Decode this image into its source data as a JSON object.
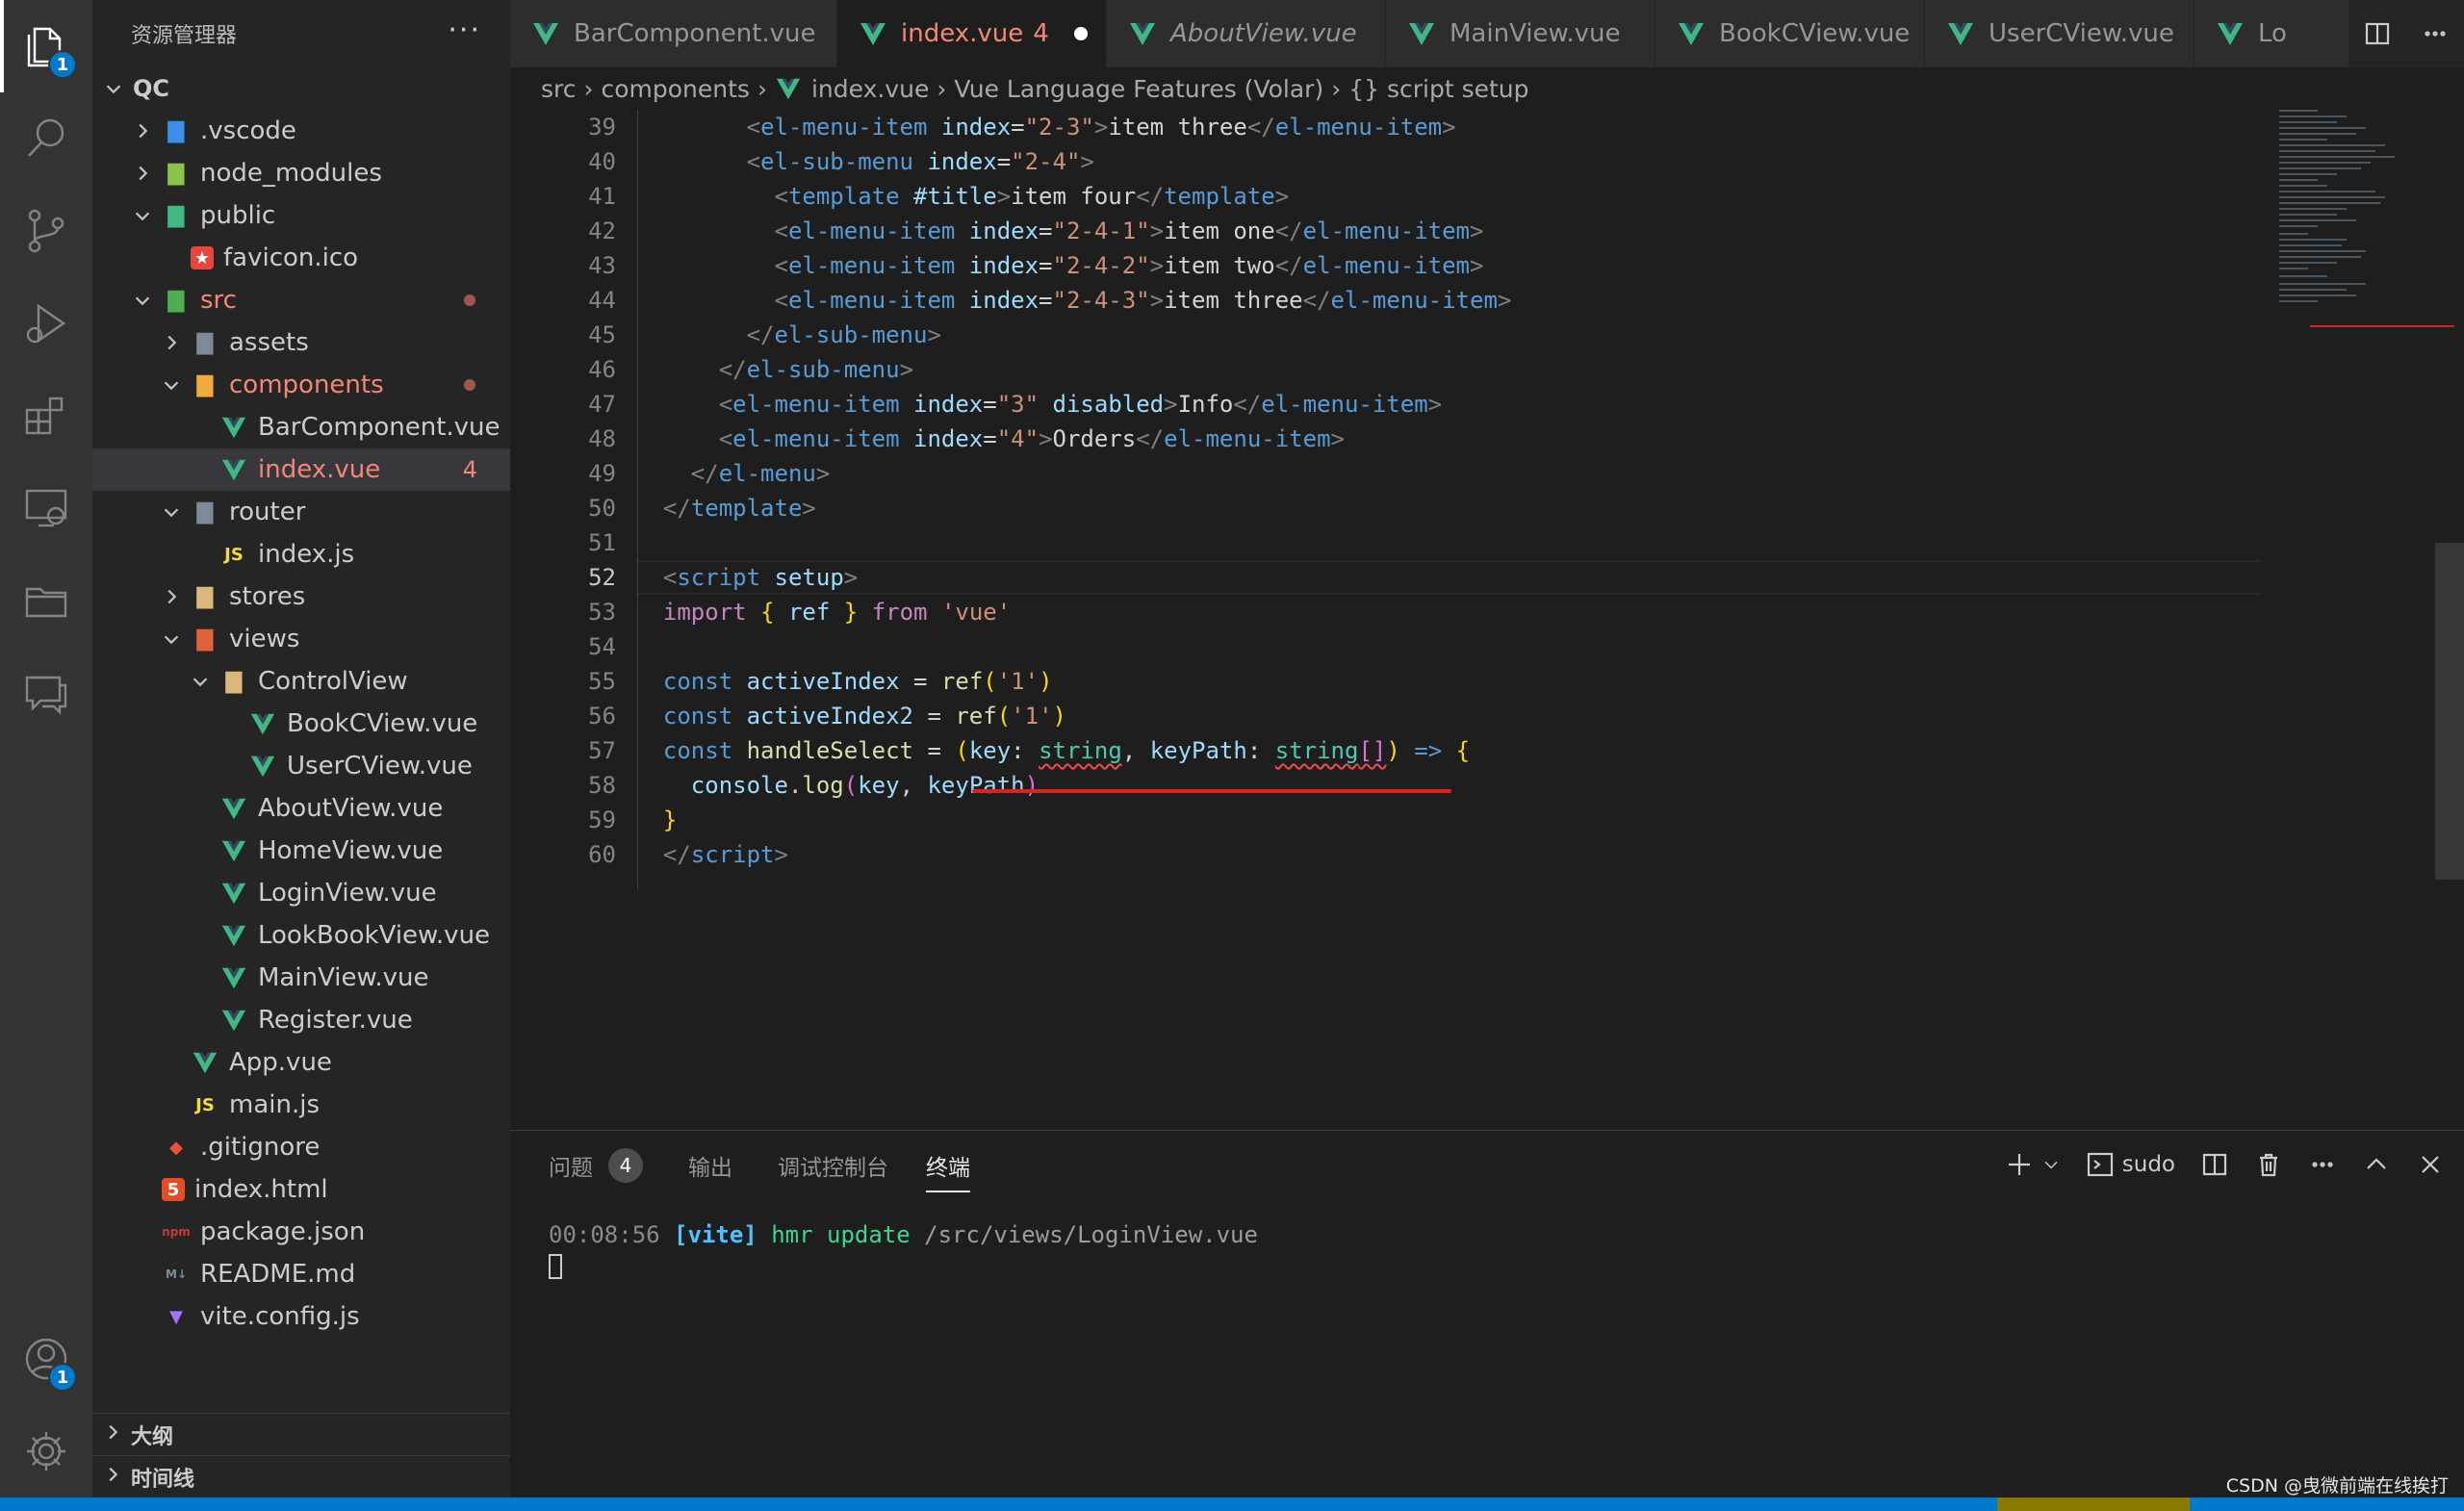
{
  "colors": {
    "vue_green": "#41b883",
    "error": "#f48771",
    "modified": "#e2c08d",
    "accent": "#007acc"
  },
  "activity_bar": {
    "explorer_badge": "1",
    "account_badge": "1"
  },
  "sidebar": {
    "title": "资源管理器",
    "more": "···",
    "root": "QC",
    "tree": [
      {
        "label": ".vscode",
        "indent": 1,
        "chevron": "right",
        "icon": "folder-vscode-icon"
      },
      {
        "label": "node_modules",
        "indent": 1,
        "chevron": "right",
        "icon": "folder-node-icon"
      },
      {
        "label": "public",
        "indent": 1,
        "chevron": "down",
        "icon": "folder-public-icon"
      },
      {
        "label": "favicon.ico",
        "indent": 2,
        "chevron": "",
        "icon": "favicon-file-icon"
      },
      {
        "label": "src",
        "indent": 1,
        "chevron": "down",
        "icon": "folder-src-icon",
        "state": "err",
        "dot": true
      },
      {
        "label": "assets",
        "indent": 2,
        "chevron": "right",
        "icon": "folder-assets-icon"
      },
      {
        "label": "components",
        "indent": 2,
        "chevron": "down",
        "icon": "folder-components-icon",
        "state": "err",
        "dot": true
      },
      {
        "label": "BarComponent.vue",
        "indent": 3,
        "chevron": "",
        "icon": "vue-file-icon"
      },
      {
        "label": "index.vue",
        "indent": 3,
        "chevron": "",
        "icon": "vue-file-icon",
        "state": "err",
        "count": "4",
        "selected": true
      },
      {
        "label": "router",
        "indent": 2,
        "chevron": "down",
        "icon": "folder-router-icon"
      },
      {
        "label": "index.js",
        "indent": 3,
        "chevron": "",
        "icon": "js-file-icon"
      },
      {
        "label": "stores",
        "indent": 2,
        "chevron": "right",
        "icon": "folder-icon"
      },
      {
        "label": "views",
        "indent": 2,
        "chevron": "down",
        "icon": "folder-views-icon"
      },
      {
        "label": "ControlView",
        "indent": 3,
        "chevron": "down",
        "icon": "folder-open-icon"
      },
      {
        "label": "BookCView.vue",
        "indent": 4,
        "chevron": "",
        "icon": "vue-file-icon"
      },
      {
        "label": "UserCView.vue",
        "indent": 4,
        "chevron": "",
        "icon": "vue-file-icon"
      },
      {
        "label": "AboutView.vue",
        "indent": 3,
        "chevron": "",
        "icon": "vue-file-icon"
      },
      {
        "label": "HomeView.vue",
        "indent": 3,
        "chevron": "",
        "icon": "vue-file-icon"
      },
      {
        "label": "LoginView.vue",
        "indent": 3,
        "chevron": "",
        "icon": "vue-file-icon"
      },
      {
        "label": "LookBookView.vue",
        "indent": 3,
        "chevron": "",
        "icon": "vue-file-icon"
      },
      {
        "label": "MainView.vue",
        "indent": 3,
        "chevron": "",
        "icon": "vue-file-icon"
      },
      {
        "label": "Register.vue",
        "indent": 3,
        "chevron": "",
        "icon": "vue-file-icon"
      },
      {
        "label": "App.vue",
        "indent": 2,
        "chevron": "",
        "icon": "vue-file-icon"
      },
      {
        "label": "main.js",
        "indent": 2,
        "chevron": "",
        "icon": "js-file-icon"
      },
      {
        "label": ".gitignore",
        "indent": 1,
        "chevron": "",
        "icon": "git-file-icon"
      },
      {
        "label": "index.html",
        "indent": 1,
        "chevron": "",
        "icon": "html-file-icon"
      },
      {
        "label": "package.json",
        "indent": 1,
        "chevron": "",
        "icon": "npm-file-icon"
      },
      {
        "label": "README.md",
        "indent": 1,
        "chevron": "",
        "icon": "markdown-file-icon"
      },
      {
        "label": "vite.config.js",
        "indent": 1,
        "chevron": "",
        "icon": "vite-file-icon"
      }
    ],
    "outline": "大纲",
    "timeline": "时间线"
  },
  "tabs": [
    {
      "label": "BarComponent.vue",
      "active": false,
      "italic": false
    },
    {
      "label": "index.vue",
      "active": true,
      "italic": false,
      "count": "4",
      "dirty": true
    },
    {
      "label": "AboutView.vue",
      "active": false,
      "italic": true
    },
    {
      "label": "MainView.vue",
      "active": false,
      "italic": false
    },
    {
      "label": "BookCView.vue",
      "active": false,
      "italic": false
    },
    {
      "label": "UserCView.vue",
      "active": false,
      "italic": false
    },
    {
      "label": "Lo",
      "active": false,
      "italic": false
    }
  ],
  "breadcrumb": {
    "src": "src",
    "components": "components",
    "file": "index.vue",
    "lang": "Vue Language Features (Volar)",
    "symbol": "{} script setup"
  },
  "editor": {
    "current_line": "52",
    "lines": [
      {
        "n": "39",
        "parts": [
          [
            "  ",
            "t-txt"
          ],
          [
            "      ",
            "t-txt"
          ],
          [
            "<",
            "t-br"
          ],
          [
            "el-menu-item",
            "t-tag"
          ],
          [
            " ",
            "t-txt"
          ],
          [
            "index",
            "t-attr"
          ],
          [
            "=",
            "t-txt"
          ],
          [
            "\"2-3\"",
            "t-str"
          ],
          [
            ">",
            "t-br"
          ],
          [
            "item three",
            "t-txt"
          ],
          [
            "</",
            "t-br"
          ],
          [
            "el-menu-item",
            "t-tag"
          ],
          [
            ">",
            "t-br"
          ]
        ]
      },
      {
        "n": "40",
        "parts": [
          [
            "        ",
            "t-txt"
          ],
          [
            "<",
            "t-br"
          ],
          [
            "el-sub-menu",
            "t-tag"
          ],
          [
            " ",
            "t-txt"
          ],
          [
            "index",
            "t-attr"
          ],
          [
            "=",
            "t-txt"
          ],
          [
            "\"2-4\"",
            "t-str"
          ],
          [
            ">",
            "t-br"
          ]
        ]
      },
      {
        "n": "41",
        "parts": [
          [
            "          ",
            "t-txt"
          ],
          [
            "<",
            "t-br"
          ],
          [
            "template",
            "t-tag"
          ],
          [
            " ",
            "t-txt"
          ],
          [
            "#title",
            "t-attr"
          ],
          [
            ">",
            "t-br"
          ],
          [
            "item four",
            "t-txt"
          ],
          [
            "</",
            "t-br"
          ],
          [
            "template",
            "t-tag"
          ],
          [
            ">",
            "t-br"
          ]
        ]
      },
      {
        "n": "42",
        "parts": [
          [
            "          ",
            "t-txt"
          ],
          [
            "<",
            "t-br"
          ],
          [
            "el-menu-item",
            "t-tag"
          ],
          [
            " ",
            "t-txt"
          ],
          [
            "index",
            "t-attr"
          ],
          [
            "=",
            "t-txt"
          ],
          [
            "\"2-4-1\"",
            "t-str"
          ],
          [
            ">",
            "t-br"
          ],
          [
            "item one",
            "t-txt"
          ],
          [
            "</",
            "t-br"
          ],
          [
            "el-menu-item",
            "t-tag"
          ],
          [
            ">",
            "t-br"
          ]
        ]
      },
      {
        "n": "43",
        "parts": [
          [
            "          ",
            "t-txt"
          ],
          [
            "<",
            "t-br"
          ],
          [
            "el-menu-item",
            "t-tag"
          ],
          [
            " ",
            "t-txt"
          ],
          [
            "index",
            "t-attr"
          ],
          [
            "=",
            "t-txt"
          ],
          [
            "\"2-4-2\"",
            "t-str"
          ],
          [
            ">",
            "t-br"
          ],
          [
            "item two",
            "t-txt"
          ],
          [
            "</",
            "t-br"
          ],
          [
            "el-menu-item",
            "t-tag"
          ],
          [
            ">",
            "t-br"
          ]
        ]
      },
      {
        "n": "44",
        "parts": [
          [
            "          ",
            "t-txt"
          ],
          [
            "<",
            "t-br"
          ],
          [
            "el-menu-item",
            "t-tag"
          ],
          [
            " ",
            "t-txt"
          ],
          [
            "index",
            "t-attr"
          ],
          [
            "=",
            "t-txt"
          ],
          [
            "\"2-4-3\"",
            "t-str"
          ],
          [
            ">",
            "t-br"
          ],
          [
            "item three",
            "t-txt"
          ],
          [
            "</",
            "t-br"
          ],
          [
            "el-menu-item",
            "t-tag"
          ],
          [
            ">",
            "t-br"
          ]
        ]
      },
      {
        "n": "45",
        "parts": [
          [
            "        ",
            "t-txt"
          ],
          [
            "</",
            "t-br"
          ],
          [
            "el-sub-menu",
            "t-tag"
          ],
          [
            ">",
            "t-br"
          ]
        ]
      },
      {
        "n": "46",
        "parts": [
          [
            "      ",
            "t-txt"
          ],
          [
            "</",
            "t-br"
          ],
          [
            "el-sub-menu",
            "t-tag"
          ],
          [
            ">",
            "t-br"
          ]
        ]
      },
      {
        "n": "47",
        "parts": [
          [
            "      ",
            "t-txt"
          ],
          [
            "<",
            "t-br"
          ],
          [
            "el-menu-item",
            "t-tag"
          ],
          [
            " ",
            "t-txt"
          ],
          [
            "index",
            "t-attr"
          ],
          [
            "=",
            "t-txt"
          ],
          [
            "\"3\"",
            "t-str"
          ],
          [
            " ",
            "t-txt"
          ],
          [
            "disabled",
            "t-attr"
          ],
          [
            ">",
            "t-br"
          ],
          [
            "Info",
            "t-txt"
          ],
          [
            "</",
            "t-br"
          ],
          [
            "el-menu-item",
            "t-tag"
          ],
          [
            ">",
            "t-br"
          ]
        ]
      },
      {
        "n": "48",
        "parts": [
          [
            "      ",
            "t-txt"
          ],
          [
            "<",
            "t-br"
          ],
          [
            "el-menu-item",
            "t-tag"
          ],
          [
            " ",
            "t-txt"
          ],
          [
            "index",
            "t-attr"
          ],
          [
            "=",
            "t-txt"
          ],
          [
            "\"4\"",
            "t-str"
          ],
          [
            ">",
            "t-br"
          ],
          [
            "Orders",
            "t-txt"
          ],
          [
            "</",
            "t-br"
          ],
          [
            "el-menu-item",
            "t-tag"
          ],
          [
            ">",
            "t-br"
          ]
        ]
      },
      {
        "n": "49",
        "parts": [
          [
            "    ",
            "t-txt"
          ],
          [
            "</",
            "t-br"
          ],
          [
            "el-menu",
            "t-tag"
          ],
          [
            ">",
            "t-br"
          ]
        ]
      },
      {
        "n": "50",
        "parts": [
          [
            "  ",
            "t-txt"
          ],
          [
            "</",
            "t-br"
          ],
          [
            "template",
            "t-tag"
          ],
          [
            ">",
            "t-br"
          ]
        ]
      },
      {
        "n": "51",
        "parts": []
      },
      {
        "n": "52",
        "parts": [
          [
            "  ",
            "t-txt"
          ],
          [
            "<",
            "t-br"
          ],
          [
            "script",
            "t-tag"
          ],
          [
            " ",
            "t-txt"
          ],
          [
            "setup",
            "t-attr"
          ],
          [
            ">",
            "t-br"
          ]
        ]
      },
      {
        "n": "53",
        "parts": [
          [
            "  ",
            "t-txt"
          ],
          [
            "import",
            "t-imp"
          ],
          [
            " ",
            "t-txt"
          ],
          [
            "{",
            "t-par"
          ],
          [
            " ",
            "t-txt"
          ],
          [
            "ref",
            "t-var"
          ],
          [
            " ",
            "t-txt"
          ],
          [
            "}",
            "t-par"
          ],
          [
            " ",
            "t-txt"
          ],
          [
            "from",
            "t-imp"
          ],
          [
            " ",
            "t-txt"
          ],
          [
            "'vue'",
            "t-str"
          ]
        ]
      },
      {
        "n": "54",
        "parts": []
      },
      {
        "n": "55",
        "parts": [
          [
            "  ",
            "t-txt"
          ],
          [
            "const",
            "t-kw"
          ],
          [
            " ",
            "t-txt"
          ],
          [
            "activeIndex",
            "t-var"
          ],
          [
            " = ",
            "t-txt"
          ],
          [
            "ref",
            "t-fn"
          ],
          [
            "(",
            "t-par"
          ],
          [
            "'1'",
            "t-str"
          ],
          [
            ")",
            "t-par"
          ]
        ]
      },
      {
        "n": "56",
        "parts": [
          [
            "  ",
            "t-txt"
          ],
          [
            "const",
            "t-kw"
          ],
          [
            " ",
            "t-txt"
          ],
          [
            "activeIndex2",
            "t-var"
          ],
          [
            " = ",
            "t-txt"
          ],
          [
            "ref",
            "t-fn"
          ],
          [
            "(",
            "t-par"
          ],
          [
            "'1'",
            "t-str"
          ],
          [
            ")",
            "t-par"
          ]
        ]
      },
      {
        "n": "57",
        "parts": [
          [
            "  ",
            "t-txt"
          ],
          [
            "const",
            "t-kw"
          ],
          [
            " ",
            "t-txt"
          ],
          [
            "handleSelect",
            "t-fn"
          ],
          [
            " = ",
            "t-txt"
          ],
          [
            "(",
            "t-par"
          ],
          [
            "key",
            "t-var"
          ],
          [
            ": ",
            "t-txt"
          ],
          [
            "string",
            "t-type squig"
          ],
          [
            ", ",
            "t-txt"
          ],
          [
            "keyPath",
            "t-var"
          ],
          [
            ": ",
            "t-txt"
          ],
          [
            "string",
            "t-type squig"
          ],
          [
            "[]",
            "t-par2 squig"
          ],
          [
            ")",
            "t-par"
          ],
          [
            " ",
            "t-txt"
          ],
          [
            "=>",
            "t-kw"
          ],
          [
            " ",
            "t-txt"
          ],
          [
            "{",
            "t-par"
          ]
        ]
      },
      {
        "n": "58",
        "parts": [
          [
            "    ",
            "t-txt"
          ],
          [
            "console",
            "t-var"
          ],
          [
            ".",
            "t-txt"
          ],
          [
            "log",
            "t-fn"
          ],
          [
            "(",
            "t-par2"
          ],
          [
            "key",
            "t-var"
          ],
          [
            ", ",
            "t-txt"
          ],
          [
            "keyPath",
            "t-var"
          ],
          [
            ")",
            "t-par2"
          ]
        ]
      },
      {
        "n": "59",
        "parts": [
          [
            "  ",
            "t-txt"
          ],
          [
            "}",
            "t-par"
          ]
        ]
      },
      {
        "n": "60",
        "parts": [
          [
            "  ",
            "t-txt"
          ],
          [
            "</",
            "t-br"
          ],
          [
            "script",
            "t-tag"
          ],
          [
            ">",
            "t-br"
          ]
        ]
      }
    ]
  },
  "panel": {
    "tabs": [
      {
        "label": "问题",
        "badge": "4",
        "active": false
      },
      {
        "label": "输出",
        "active": false
      },
      {
        "label": "调试控制台",
        "active": false
      },
      {
        "label": "终端",
        "active": true
      }
    ],
    "shell": "sudo",
    "terminal": {
      "time": "00:08:56",
      "tag": "[vite]",
      "action": "hmr update",
      "path": "/src/views/LoginView.vue"
    }
  },
  "watermark": "CSDN @曳微前端在线挨打"
}
